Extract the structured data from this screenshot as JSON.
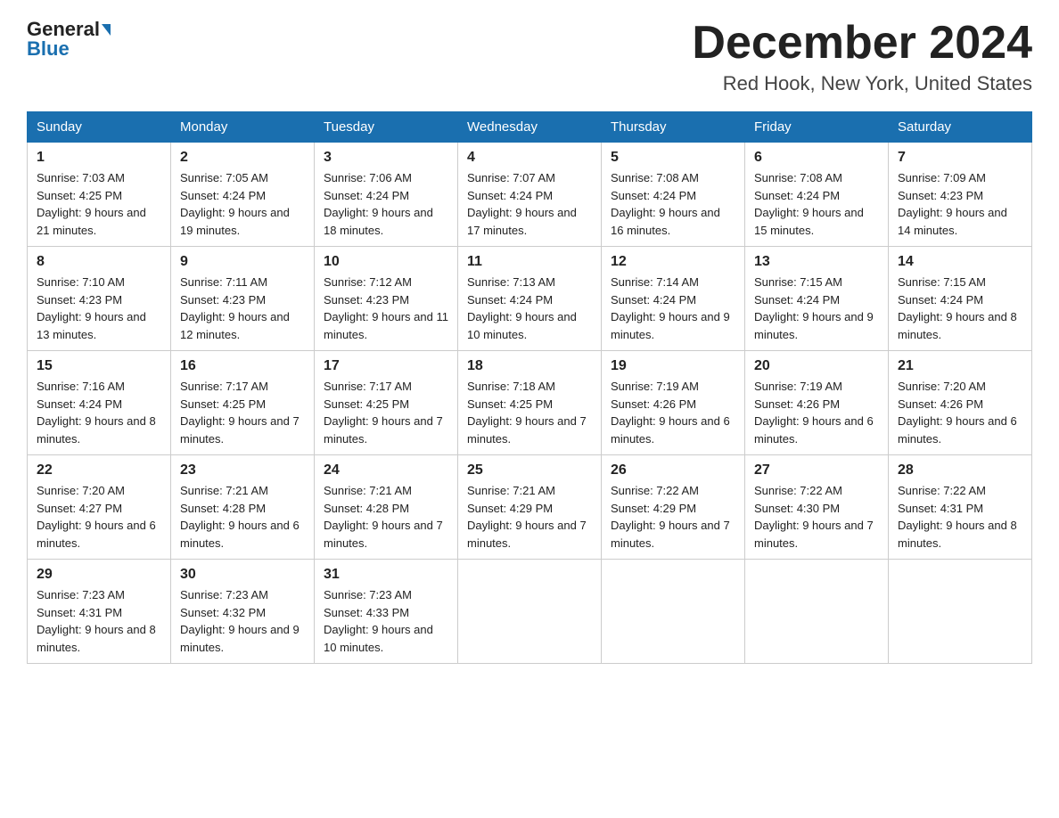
{
  "header": {
    "logo_line1": "General",
    "logo_line2": "Blue",
    "title": "December 2024",
    "subtitle": "Red Hook, New York, United States"
  },
  "days_of_week": [
    "Sunday",
    "Monday",
    "Tuesday",
    "Wednesday",
    "Thursday",
    "Friday",
    "Saturday"
  ],
  "weeks": [
    [
      {
        "day": "1",
        "sunrise": "7:03 AM",
        "sunset": "4:25 PM",
        "daylight": "9 hours and 21 minutes."
      },
      {
        "day": "2",
        "sunrise": "7:05 AM",
        "sunset": "4:24 PM",
        "daylight": "9 hours and 19 minutes."
      },
      {
        "day": "3",
        "sunrise": "7:06 AM",
        "sunset": "4:24 PM",
        "daylight": "9 hours and 18 minutes."
      },
      {
        "day": "4",
        "sunrise": "7:07 AM",
        "sunset": "4:24 PM",
        "daylight": "9 hours and 17 minutes."
      },
      {
        "day": "5",
        "sunrise": "7:08 AM",
        "sunset": "4:24 PM",
        "daylight": "9 hours and 16 minutes."
      },
      {
        "day": "6",
        "sunrise": "7:08 AM",
        "sunset": "4:24 PM",
        "daylight": "9 hours and 15 minutes."
      },
      {
        "day": "7",
        "sunrise": "7:09 AM",
        "sunset": "4:23 PM",
        "daylight": "9 hours and 14 minutes."
      }
    ],
    [
      {
        "day": "8",
        "sunrise": "7:10 AM",
        "sunset": "4:23 PM",
        "daylight": "9 hours and 13 minutes."
      },
      {
        "day": "9",
        "sunrise": "7:11 AM",
        "sunset": "4:23 PM",
        "daylight": "9 hours and 12 minutes."
      },
      {
        "day": "10",
        "sunrise": "7:12 AM",
        "sunset": "4:23 PM",
        "daylight": "9 hours and 11 minutes."
      },
      {
        "day": "11",
        "sunrise": "7:13 AM",
        "sunset": "4:24 PM",
        "daylight": "9 hours and 10 minutes."
      },
      {
        "day": "12",
        "sunrise": "7:14 AM",
        "sunset": "4:24 PM",
        "daylight": "9 hours and 9 minutes."
      },
      {
        "day": "13",
        "sunrise": "7:15 AM",
        "sunset": "4:24 PM",
        "daylight": "9 hours and 9 minutes."
      },
      {
        "day": "14",
        "sunrise": "7:15 AM",
        "sunset": "4:24 PM",
        "daylight": "9 hours and 8 minutes."
      }
    ],
    [
      {
        "day": "15",
        "sunrise": "7:16 AM",
        "sunset": "4:24 PM",
        "daylight": "9 hours and 8 minutes."
      },
      {
        "day": "16",
        "sunrise": "7:17 AM",
        "sunset": "4:25 PM",
        "daylight": "9 hours and 7 minutes."
      },
      {
        "day": "17",
        "sunrise": "7:17 AM",
        "sunset": "4:25 PM",
        "daylight": "9 hours and 7 minutes."
      },
      {
        "day": "18",
        "sunrise": "7:18 AM",
        "sunset": "4:25 PM",
        "daylight": "9 hours and 7 minutes."
      },
      {
        "day": "19",
        "sunrise": "7:19 AM",
        "sunset": "4:26 PM",
        "daylight": "9 hours and 6 minutes."
      },
      {
        "day": "20",
        "sunrise": "7:19 AM",
        "sunset": "4:26 PM",
        "daylight": "9 hours and 6 minutes."
      },
      {
        "day": "21",
        "sunrise": "7:20 AM",
        "sunset": "4:26 PM",
        "daylight": "9 hours and 6 minutes."
      }
    ],
    [
      {
        "day": "22",
        "sunrise": "7:20 AM",
        "sunset": "4:27 PM",
        "daylight": "9 hours and 6 minutes."
      },
      {
        "day": "23",
        "sunrise": "7:21 AM",
        "sunset": "4:28 PM",
        "daylight": "9 hours and 6 minutes."
      },
      {
        "day": "24",
        "sunrise": "7:21 AM",
        "sunset": "4:28 PM",
        "daylight": "9 hours and 7 minutes."
      },
      {
        "day": "25",
        "sunrise": "7:21 AM",
        "sunset": "4:29 PM",
        "daylight": "9 hours and 7 minutes."
      },
      {
        "day": "26",
        "sunrise": "7:22 AM",
        "sunset": "4:29 PM",
        "daylight": "9 hours and 7 minutes."
      },
      {
        "day": "27",
        "sunrise": "7:22 AM",
        "sunset": "4:30 PM",
        "daylight": "9 hours and 7 minutes."
      },
      {
        "day": "28",
        "sunrise": "7:22 AM",
        "sunset": "4:31 PM",
        "daylight": "9 hours and 8 minutes."
      }
    ],
    [
      {
        "day": "29",
        "sunrise": "7:23 AM",
        "sunset": "4:31 PM",
        "daylight": "9 hours and 8 minutes."
      },
      {
        "day": "30",
        "sunrise": "7:23 AM",
        "sunset": "4:32 PM",
        "daylight": "9 hours and 9 minutes."
      },
      {
        "day": "31",
        "sunrise": "7:23 AM",
        "sunset": "4:33 PM",
        "daylight": "9 hours and 10 minutes."
      },
      null,
      null,
      null,
      null
    ]
  ]
}
